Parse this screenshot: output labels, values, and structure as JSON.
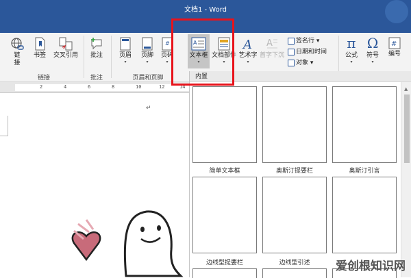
{
  "window": {
    "title": "文档1 - Word"
  },
  "ribbon": {
    "links_group": {
      "label": "链接",
      "items": [
        {
          "label": "链\n接"
        },
        {
          "label": "书签"
        },
        {
          "label": "交叉引用"
        }
      ]
    },
    "comments_group": {
      "label": "批注",
      "items": [
        {
          "label": "批注"
        }
      ]
    },
    "header_footer_group": {
      "label": "页眉和页脚",
      "items": [
        {
          "label": "页眉"
        },
        {
          "label": "页脚"
        },
        {
          "label": "页码"
        }
      ]
    },
    "text_group": {
      "textbox": "文本框",
      "quickparts": "文档部件",
      "wordart": "艺术字",
      "dropcap": "首字下沉",
      "signature": "签名行",
      "datetime": "日期和时间",
      "object": "对象"
    },
    "symbols_group": {
      "equation": "公式",
      "symbol": "符号",
      "number": "编号"
    }
  },
  "ruler": {
    "marks": [
      "2",
      "4",
      "6",
      "8",
      "10",
      "12",
      "14"
    ]
  },
  "gallery": {
    "section": "内置",
    "items": [
      {
        "label": "简单文本框"
      },
      {
        "label": "奥斯汀提要栏"
      },
      {
        "label": "奥斯汀引言"
      },
      {
        "label": "边线型提要栏"
      },
      {
        "label": "边线型引述"
      },
      {
        "label": ""
      }
    ]
  },
  "doc": {
    "paragraph_mark": "↵"
  },
  "watermark": "爱创根知识网",
  "colors": {
    "title_bar": "#2b579a",
    "highlight": "#e8131b"
  }
}
